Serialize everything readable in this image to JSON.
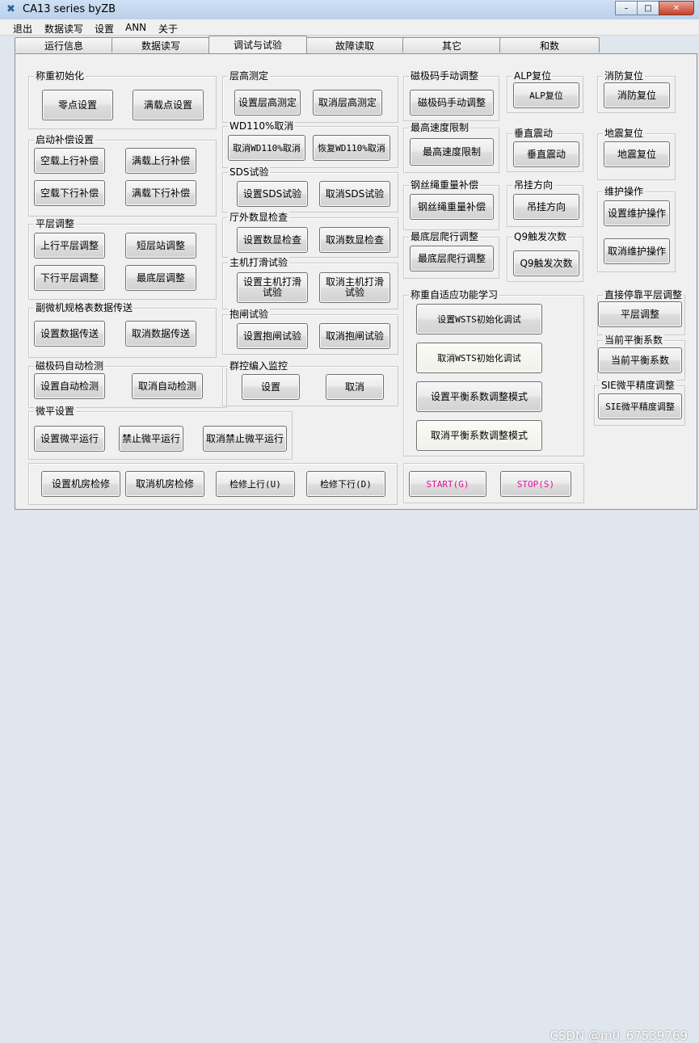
{
  "window": {
    "title": "CA13 series byZB",
    "controls": {
      "minimize": "–",
      "maximize": "□",
      "close": "✕"
    }
  },
  "menu": [
    "退出",
    "数据读写",
    "设置",
    "ANN",
    "关于"
  ],
  "tabs": [
    "运行信息",
    "数据读写",
    "调试与试验",
    "故障读取",
    "其它",
    "和数"
  ],
  "groups": {
    "weigh_init": {
      "label": "称重初始化",
      "buttons": [
        "零点设置",
        "满载点设置"
      ]
    },
    "start_comp": {
      "label": "启动补偿设置",
      "buttons": [
        "空载上行补偿",
        "满载上行补偿",
        "空载下行补偿",
        "满载下行补偿"
      ]
    },
    "level_adj": {
      "label": "平层调整",
      "buttons": [
        "上行平层调整",
        "短层站调整",
        "下行平层调整",
        "最底层调整"
      ]
    },
    "sub_micro": {
      "label": "副微机规格表数据传送",
      "buttons": [
        "设置数据传送",
        "取消数据传送"
      ]
    },
    "magnet_auto": {
      "label": "磁极码自动检测",
      "buttons": [
        "设置自动检测",
        "取消自动检测"
      ]
    },
    "micro_level": {
      "label": "微平设置",
      "buttons": [
        "设置微平运行",
        "禁止微平运行",
        "取消禁止微平运行"
      ]
    },
    "bottom_row": {
      "buttons": [
        "设置机房检修",
        "取消机房检修",
        "检修上行(U)",
        "检修下行(D)"
      ]
    },
    "floor_height": {
      "label": "层高测定",
      "buttons": [
        "设置层高测定",
        "取消层高测定"
      ]
    },
    "wd110": {
      "label": "WD110%取消",
      "buttons": [
        "取消WD110%取消",
        "恢复WD110%取消"
      ]
    },
    "sds": {
      "label": "SDS试验",
      "buttons": [
        "设置SDS试验",
        "取消SDS试验"
      ]
    },
    "hall_display": {
      "label": "厅外数显检查",
      "buttons": [
        "设置数显检查",
        "取消数显检查"
      ]
    },
    "main_slip": {
      "label": "主机打滑试验",
      "buttons": [
        "设置主机打滑试验",
        "取消主机打滑试验"
      ]
    },
    "brake": {
      "label": "抱闸试验",
      "buttons": [
        "设置抱闸试验",
        "取消抱闸试验"
      ]
    },
    "group_monitor": {
      "label": "群控编入监控",
      "buttons": [
        "设置",
        "取消"
      ]
    },
    "magnet_manual": {
      "label": "磁极码手动调整",
      "buttons": [
        "磁极码手动调整"
      ]
    },
    "max_speed": {
      "label": "最高速度限制",
      "buttons": [
        "最高速度限制"
      ]
    },
    "rope_comp": {
      "label": "钢丝绳重量补偿",
      "buttons": [
        "钢丝绳重量补偿"
      ]
    },
    "bottom_creep": {
      "label": "最底层爬行调整",
      "buttons": [
        "最底层爬行调整"
      ]
    },
    "alp": {
      "label": "ALP复位",
      "buttons": [
        "ALP复位"
      ]
    },
    "vertical_vib": {
      "label": "垂直震动",
      "buttons": [
        "垂直震动"
      ]
    },
    "hang_dir": {
      "label": "吊挂方向",
      "buttons": [
        "吊挂方向"
      ]
    },
    "q9": {
      "label": "Q9触发次数",
      "buttons": [
        "Q9触发次数"
      ]
    },
    "fire_reset": {
      "label": "消防复位",
      "buttons": [
        "消防复位"
      ]
    },
    "quake_reset": {
      "label": "地震复位",
      "buttons": [
        "地震复位"
      ]
    },
    "maintenance": {
      "label": "维护操作",
      "buttons": [
        "设置维护操作",
        "取消维护操作"
      ]
    },
    "weigh_learn": {
      "label": "称重自适应功能学习",
      "buttons": [
        "设置WSTS初始化调试",
        "取消WSTS初始化调试",
        "设置平衡系数调整模式",
        "取消平衡系数调整模式"
      ]
    },
    "start_stop": {
      "buttons": [
        "START(G)",
        "STOP(S)"
      ]
    },
    "direct_stop": {
      "label": "直接停靠平层调整",
      "buttons": [
        "平层调整"
      ]
    },
    "balance": {
      "label": "当前平衡系数",
      "buttons": [
        "当前平衡系数"
      ]
    },
    "sie": {
      "label": "SIE微平精度调整",
      "buttons": [
        "SIE微平精度调整"
      ]
    }
  },
  "watermark": "CSDN @m0_67539769",
  "colors": {
    "accent_magenta": "#e0149c",
    "panel": "#f0f0f0",
    "frame": "#dfe6ee"
  }
}
